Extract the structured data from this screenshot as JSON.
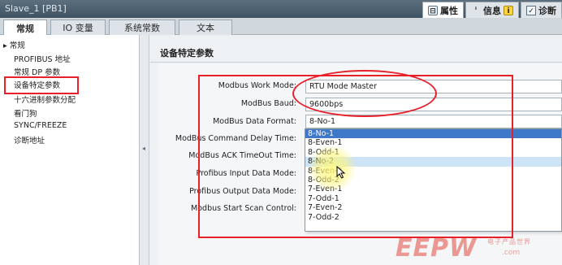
{
  "window": {
    "title": "Slave_1 [PB1]"
  },
  "right_tabs": [
    {
      "label": "属性",
      "icon": "properties-icon"
    },
    {
      "label": "信息",
      "icon": "info-icon"
    },
    {
      "label": "诊断",
      "icon": "diagnostics-icon"
    }
  ],
  "tabs": [
    {
      "label": "常规"
    },
    {
      "label": "IO 变量"
    },
    {
      "label": "系统常数"
    },
    {
      "label": "文本"
    }
  ],
  "nav": {
    "items": [
      {
        "label": "▸ 常规"
      },
      {
        "label": "PROFIBUS 地址"
      },
      {
        "label": "常规 DP 参数"
      },
      {
        "label": "设备特定参数"
      },
      {
        "label": "十六进制参数分配"
      },
      {
        "label": "看门狗"
      },
      {
        "label": "SYNC/FREEZE"
      },
      {
        "label": "诊断地址"
      }
    ],
    "selected": "设备特定参数"
  },
  "section": {
    "title": "设备特定参数"
  },
  "params": [
    {
      "label": "Modbus Work Mode:",
      "value": "RTU Mode Master"
    },
    {
      "label": "ModBus Baud:",
      "value": "9600bps"
    },
    {
      "label": "ModBus Data Format:",
      "value": "8-No-1"
    },
    {
      "label": "ModBus Command Delay Time:",
      "value": ""
    },
    {
      "label": "ModBus ACK TimeOut Time:",
      "value": ""
    },
    {
      "label": "Profibus Input Data Mode:",
      "value": ""
    },
    {
      "label": "Profibus Output Data Mode:",
      "value": ""
    },
    {
      "label": "Modbus Start Scan Control:",
      "value": ""
    }
  ],
  "dropdown": {
    "options": [
      "8-No-1",
      "8-Even-1",
      "8-Odd-1",
      "8-No-2",
      "8-Even-2",
      "8-Odd-2",
      "7-Even-1",
      "7-Odd-1",
      "7-Even-2",
      "7-Odd-2"
    ],
    "selected": "8-No-1",
    "hovered": "8-No-2"
  },
  "colors": {
    "annotation_red": "#e8202a",
    "selection_blue": "#3d78c9",
    "hover_blue": "#cde4f7"
  },
  "watermark": {
    "logo": "EEPW",
    "text": "电子产品世界",
    "url": ".com"
  }
}
